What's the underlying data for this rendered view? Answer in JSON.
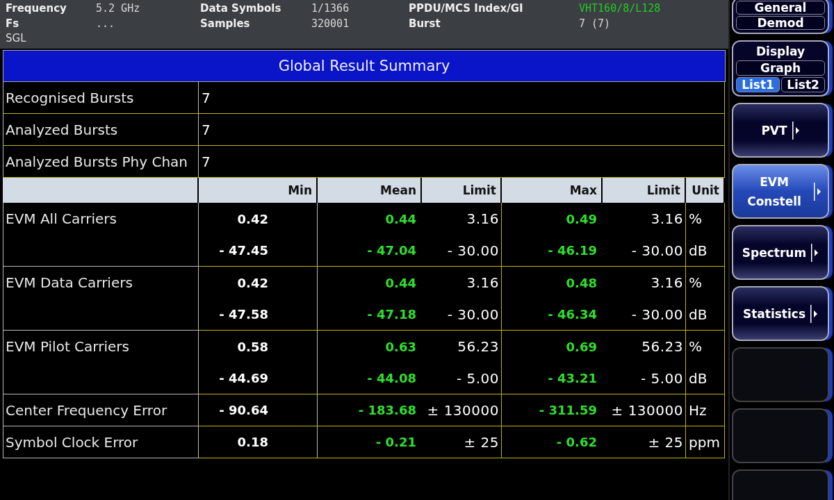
{
  "header": {
    "rows": [
      [
        {
          "label": "Frequency",
          "value": "5.2 GHz",
          "color": "#d8d8d8"
        },
        {
          "label": "Data Symbols",
          "value": "1/1366",
          "color": "#d8d8d8"
        },
        {
          "label": "PPDU/MCS Index/GI",
          "value": "VHT160/8/L128",
          "color": "#22cc22"
        }
      ],
      [
        {
          "label": "Fs",
          "value": "...",
          "color": "#d8d8d8"
        },
        {
          "label": "Samples",
          "value": "320001",
          "color": "#d8d8d8"
        },
        {
          "label": "Burst",
          "value": "7 (7)",
          "color": "#d8d8d8"
        }
      ]
    ],
    "mode": "SGL"
  },
  "table": {
    "title": "Global Result Summary",
    "summary": [
      {
        "label": "Recognised Bursts",
        "value": "7"
      },
      {
        "label": "Analyzed Bursts",
        "value": "7"
      },
      {
        "label": "Analyzed Bursts Phy Chan",
        "value": "7"
      }
    ],
    "columns": [
      "Min",
      "Mean",
      "Limit",
      "Max",
      "Limit",
      "Unit"
    ],
    "measurements": [
      {
        "label": "EVM All Carriers",
        "lines": [
          {
            "min": "0.42",
            "mean": "0.44",
            "mean_limit": "3.16",
            "max": "0.49",
            "max_limit": "3.16",
            "unit": "%"
          },
          {
            "min": "- 47.45",
            "mean": "- 47.04",
            "mean_limit": "- 30.00",
            "max": "- 46.19",
            "max_limit": "- 30.00",
            "unit": "dB"
          }
        ]
      },
      {
        "label": "EVM Data Carriers",
        "lines": [
          {
            "min": "0.42",
            "mean": "0.44",
            "mean_limit": "3.16",
            "max": "0.48",
            "max_limit": "3.16",
            "unit": "%"
          },
          {
            "min": "- 47.58",
            "mean": "- 47.18",
            "mean_limit": "- 30.00",
            "max": "- 46.34",
            "max_limit": "- 30.00",
            "unit": "dB"
          }
        ]
      },
      {
        "label": "EVM Pilot Carriers",
        "lines": [
          {
            "min": "0.58",
            "mean": "0.63",
            "mean_limit": "56.23",
            "max": "0.69",
            "max_limit": "56.23",
            "unit": "%"
          },
          {
            "min": "- 44.69",
            "mean": "- 44.08",
            "mean_limit": "- 5.00",
            "max": "- 43.21",
            "max_limit": "- 5.00",
            "unit": "dB"
          }
        ]
      },
      {
        "label": "Center Frequency Error",
        "lines": [
          {
            "min": "- 90.64",
            "mean": "- 183.68",
            "mean_limit": "± 130000",
            "max": "- 311.59",
            "max_limit": "± 130000",
            "unit": "Hz"
          }
        ]
      },
      {
        "label": "Symbol Clock Error",
        "lines": [
          {
            "min": "0.18",
            "mean": "- 0.21",
            "mean_limit": "± 25",
            "max": "- 0.62",
            "max_limit": "± 25",
            "unit": "ppm"
          }
        ]
      }
    ]
  },
  "softkeys": [
    {
      "kind": "group",
      "options": [
        {
          "label": "General",
          "selected": false
        },
        {
          "label": "Demod",
          "selected": false
        }
      ]
    },
    {
      "kind": "toggle",
      "label": "Display",
      "options": [
        {
          "label": "Graph",
          "selected": false
        },
        {
          "label": "List1",
          "selected": true
        },
        {
          "label": "List2",
          "selected": false
        }
      ]
    },
    {
      "kind": "menu",
      "label": "PVT",
      "selected": false
    },
    {
      "kind": "menu",
      "label": "EVM Constell",
      "selected": true
    },
    {
      "kind": "menu",
      "label": "Spectrum",
      "selected": false
    },
    {
      "kind": "menu",
      "label": "Statistics",
      "selected": false
    },
    {
      "kind": "empty"
    },
    {
      "kind": "empty"
    },
    {
      "kind": "empty"
    }
  ]
}
